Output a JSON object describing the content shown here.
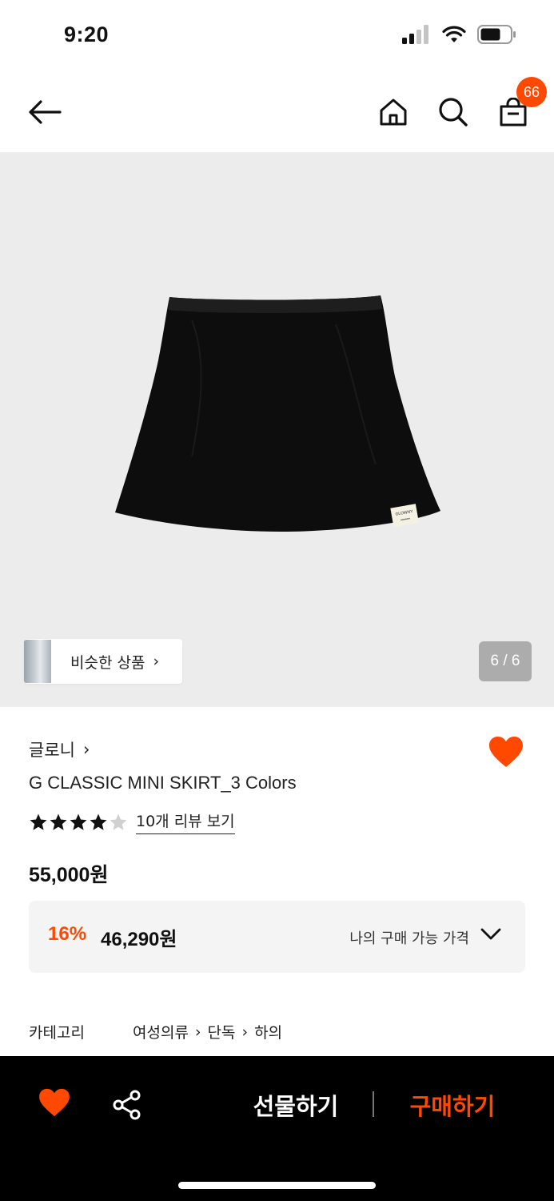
{
  "status_bar": {
    "time": "9:20"
  },
  "header": {
    "back_icon": "arrow-left-icon",
    "home_icon": "home-icon",
    "search_icon": "search-icon",
    "cart_icon": "shopping-bag-icon",
    "cart_count": "66"
  },
  "gallery": {
    "similar_label": "비슷한 상품",
    "similar_chevron": "›",
    "page_counter": "6 / 6",
    "product_label": "GLOWNY"
  },
  "product": {
    "brand": "글로니",
    "brand_chevron": "›",
    "name": "G CLASSIC MINI SKIRT_3 Colors",
    "rating": 4,
    "rating_max": 5,
    "review_link": "10개 리뷰 보기",
    "price": "55,000원",
    "discount": "16%",
    "sale_price": "46,290원",
    "my_price_label": "나의 구매 가능 가격"
  },
  "category": {
    "label": "카테고리",
    "path": [
      "여성의류",
      "단독",
      "하의"
    ],
    "separator": "›"
  },
  "bottom_bar": {
    "gift_label": "선물하기",
    "buy_label": "구매하기"
  },
  "colors": {
    "accent": "#ff4800",
    "gallery_bg": "#ececec",
    "bottom_bg": "#000000"
  }
}
